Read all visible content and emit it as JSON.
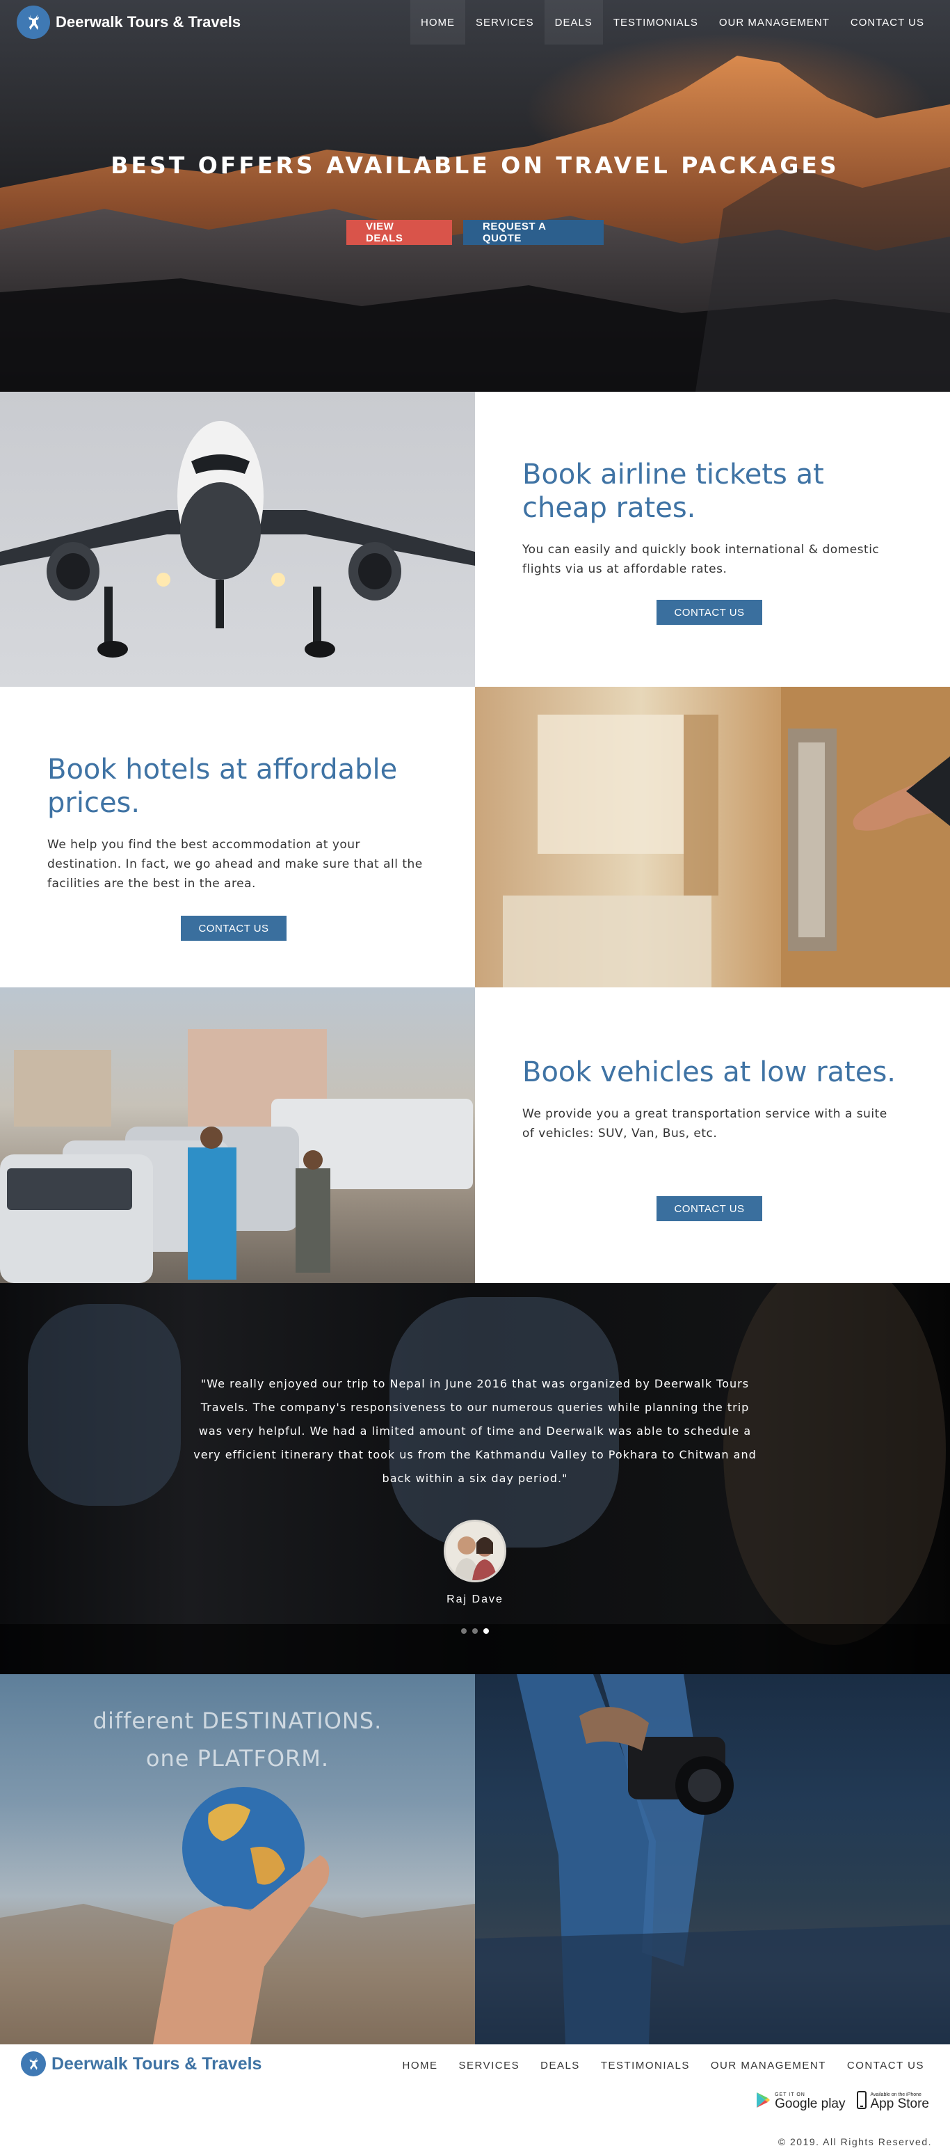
{
  "brand": {
    "name": "Deerwalk Tours & Travels",
    "accent": "#3f73a4",
    "red": "#d9544a"
  },
  "nav": {
    "items": [
      "HOME",
      "SERVICES",
      "DEALS",
      "TESTIMONIALS",
      "OUR MANAGEMENT",
      "CONTACT US"
    ]
  },
  "hero": {
    "title": "BEST OFFERS AVAILABLE ON TRAVEL PACKAGES",
    "primary_button": "VIEW DEALS",
    "secondary_button": "REQUEST A QUOTE"
  },
  "features": [
    {
      "title": "Book airline tickets at cheap rates.",
      "description": "You can easily and quickly book international & domestic flights via us at affordable rates.",
      "button": "CONTACT US"
    },
    {
      "title": "Book hotels at affordable prices.",
      "description": "We help you find the best accommodation at your destination. In fact, we go ahead and make sure that all the facilities are the best in the area.",
      "button": "CONTACT US"
    },
    {
      "title": "Book vehicles at low rates.",
      "description": "We provide you a great transportation service with a suite of vehicles: SUV, Van, Bus, etc.",
      "button": "CONTACT US"
    }
  ],
  "testimonial": {
    "quote": "\"We really enjoyed our trip to Nepal in June 2016 that was organized by Deerwalk Tours Travels. The company's responsiveness to our numerous queries while planning the trip was very helpful. We had a limited amount of time and Deerwalk was able to schedule a very efficient itinerary that took us from the Kathmandu Valley to Pokhara to Chitwan and back within a six day period.\"",
    "author": "Raj Dave",
    "slides": 3,
    "active_slide": 3
  },
  "destinations": {
    "line1": "different DESTINATIONS.",
    "line2": "one PLATFORM."
  },
  "footer": {
    "brand": "Deerwalk Tours & Travels",
    "nav": [
      "HOME",
      "SERVICES",
      "DEALS",
      "TESTIMONIALS",
      "OUR MANAGEMENT",
      "CONTACT US"
    ],
    "google_play": "Google play",
    "google_play_small": "GET IT ON",
    "app_store": "App Store",
    "app_store_small": "Available on the iPhone",
    "copyright": "© 2019. All Rights Reserved."
  }
}
